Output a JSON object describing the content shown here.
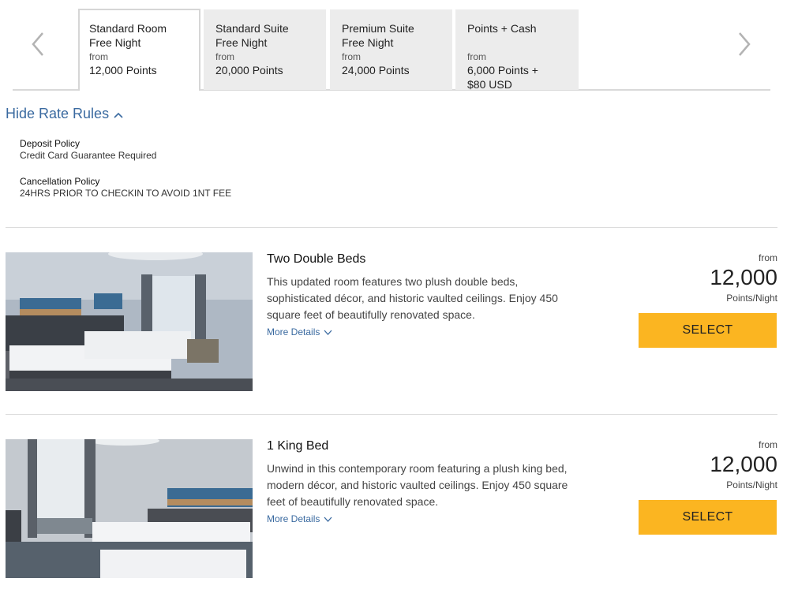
{
  "tabs": [
    {
      "name_line1": "Standard Room",
      "name_line2": "Free Night",
      "from": "from",
      "price_line1": "12,000 Points",
      "price_line2": ""
    },
    {
      "name_line1": "Standard Suite",
      "name_line2": "Free Night",
      "from": "from",
      "price_line1": "20,000 Points",
      "price_line2": ""
    },
    {
      "name_line1": "Premium Suite",
      "name_line2": "Free Night",
      "from": "from",
      "price_line1": "24,000 Points",
      "price_line2": ""
    },
    {
      "name_line1": "Points + Cash",
      "name_line2": "",
      "from": "from",
      "price_line1": "6,000 Points +",
      "price_line2": "$80 USD"
    }
  ],
  "rate_rules": {
    "toggle_label": "Hide Rate Rules",
    "deposit_title": "Deposit Policy",
    "deposit_value": "Credit Card Guarantee Required",
    "cancel_title": "Cancellation Policy",
    "cancel_value": "24HRS PRIOR TO CHECKIN TO AVOID 1NT FEE"
  },
  "rooms": [
    {
      "title": "Two Double Beds",
      "description": "This updated room features two plush double beds, sophisticated décor, and historic vaulted ceilings. Enjoy 450 square feet of beautifully renovated space.",
      "more_details": "More Details",
      "from": "from",
      "price": "12,000",
      "unit": "Points/Night",
      "select": "SELECT"
    },
    {
      "title": "1 King Bed",
      "description": "Unwind in this contemporary room featuring a plush king bed, modern décor, and historic vaulted ceilings. Enjoy 450 square feet of beautifully renovated space.",
      "more_details": "More Details",
      "from": "from",
      "price": "12,000",
      "unit": "Points/Night",
      "select": "SELECT"
    }
  ],
  "colors": {
    "accent_link": "#3a6aa0",
    "select_button": "#fbb521",
    "tab_inactive": "#ececec"
  },
  "icons": {
    "prev": "chevron-left-icon",
    "next": "chevron-right-icon",
    "collapse": "chevron-up-icon",
    "expand": "chevron-down-icon"
  }
}
